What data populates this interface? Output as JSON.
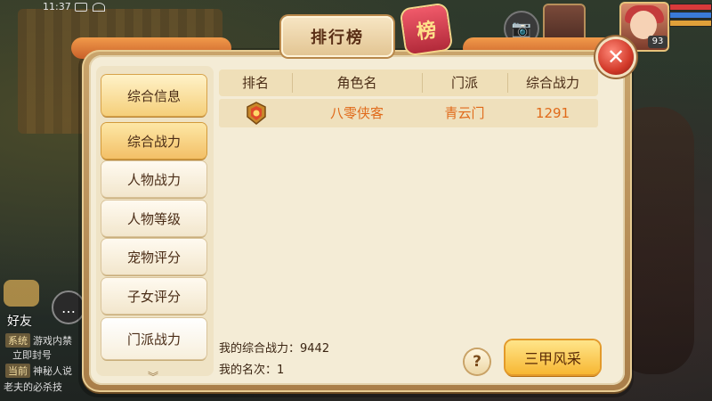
{
  "status_bar": {
    "time": "11:37"
  },
  "player": {
    "level": "93"
  },
  "title": {
    "text": "排行榜",
    "emblem_glyph": "榜"
  },
  "close_glyph": "✕",
  "categories": {
    "header": "综合信息",
    "items": [
      {
        "label": "综合战力",
        "selected": true
      },
      {
        "label": "人物战力"
      },
      {
        "label": "人物等级"
      },
      {
        "label": "宠物评分"
      },
      {
        "label": "子女评分"
      },
      {
        "label": "门派战力"
      }
    ],
    "scroll_more_glyph": "︾"
  },
  "table": {
    "columns": [
      "排名",
      "角色名",
      "门派",
      "综合战力"
    ],
    "rows": [
      {
        "rank_icon": "rank-medal-icon",
        "name": "八零侠客",
        "sect": "青云门",
        "power": "1291"
      }
    ]
  },
  "footer": {
    "my_power_label": "我的综合战力：",
    "my_power": "9442",
    "my_rank_label": "我的名次：",
    "my_rank": "1",
    "help_glyph": "?",
    "action_button": "三甲风采"
  },
  "chat": {
    "friends": "好友",
    "lines": [
      {
        "tag": "系统",
        "text": "游戏内禁"
      },
      {
        "tag": "",
        "text": "立即封号"
      },
      {
        "tag": "当前",
        "text": "神秘人说"
      },
      {
        "tag": "",
        "text": "老夫的必杀技"
      }
    ]
  },
  "colors": {
    "accent_orange": "#e06a1a",
    "button_gold": "#f7b733",
    "close_red": "#d23a2a",
    "panel_cream": "#f4ecd6"
  }
}
